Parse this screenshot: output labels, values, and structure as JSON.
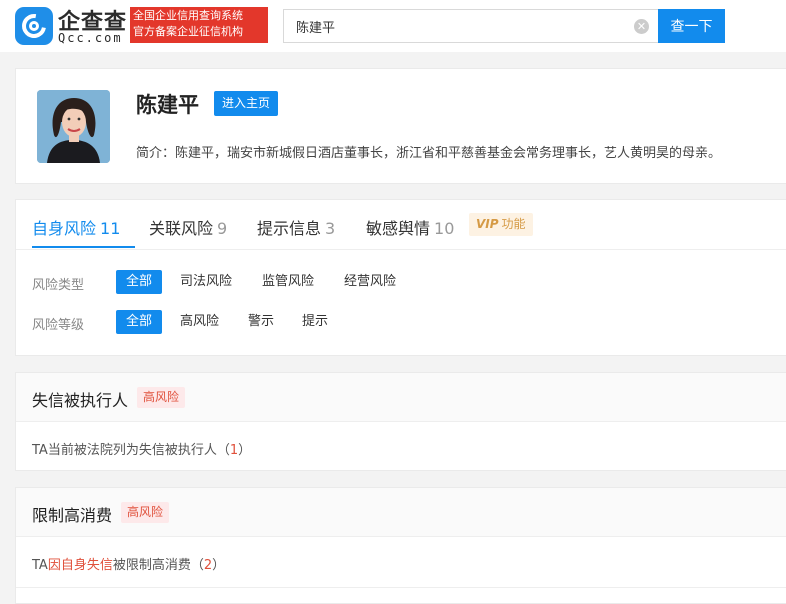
{
  "header": {
    "brand_name": "企查查",
    "brand_domain": "Qcc.com",
    "slogan_line1": "全国企业信用查询系统",
    "slogan_line2": "官方备案企业征信机构",
    "search_value": "陈建平",
    "search_button": "查一下"
  },
  "profile": {
    "name": "陈建平",
    "homepage_button": "进入主页",
    "intro": "简介：陈建平，瑞安市新城假日酒店董事长，浙江省和平慈善基金会常务理事长，艺人黄明昊的母亲。"
  },
  "risk_tabs": [
    {
      "label": "自身风险",
      "count": "11"
    },
    {
      "label": "关联风险",
      "count": "9"
    },
    {
      "label": "提示信息",
      "count": "3"
    },
    {
      "label": "敏感舆情",
      "count": "10"
    }
  ],
  "vip": {
    "label": "VIP",
    "text": "功能"
  },
  "filters": {
    "type_label": "风险类型",
    "type_options": [
      "全部",
      "司法风险",
      "监管风险",
      "经营风险"
    ],
    "level_label": "风险等级",
    "level_options": [
      "全部",
      "高风险",
      "警示",
      "提示"
    ]
  },
  "sections": [
    {
      "title": "失信被执行人",
      "tag": "高风险",
      "line_text": "TA当前被法院列为失信被执行人（",
      "line_count": "1",
      "line_end": "）"
    },
    {
      "title": "限制高消费",
      "tag": "高风险",
      "line_prefix": "TA",
      "line_highlight": "因自身失信",
      "line_rest": "被限制高消费（",
      "line_count": "2",
      "line_end": "）"
    }
  ],
  "colors": {
    "accent": "#128bed",
    "brand_red": "#e3372b",
    "risk_red": "#e0503b",
    "vip_gold": "#d59a45"
  }
}
